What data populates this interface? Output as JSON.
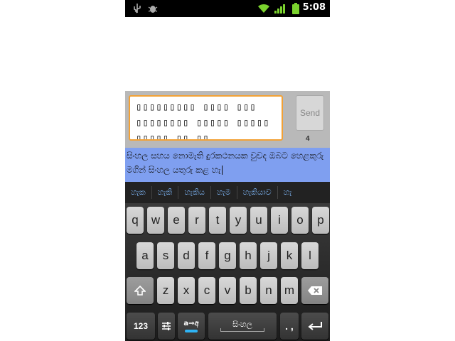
{
  "status_bar": {
    "time": "5:08",
    "icons": [
      "usb-icon",
      "debug-bug-icon",
      "wifi-icon",
      "signal-icon",
      "battery-icon"
    ]
  },
  "compose": {
    "message_text": "▯▯▯▯▯▯▯▯▯ ▯▯▯▯ ▯▯▯ ▯▯▯▯▯▯▯▯ ▯▯▯▯▯ ▯▯▯▯▯ ▯▯▯▯▯ ▯▯ ▯▯",
    "send_label": "Send",
    "char_count": "4"
  },
  "composing_text": "සිංහල සහය නොමැති දුරකථනයක වුවද ඔබට හෙළකුරු මගින් සිංහල යතුරු කළ හැ",
  "suggestions": [
    "හැක",
    "හැකි",
    "හැකිය",
    "හැම",
    "හැකියාව",
    "හැ"
  ],
  "keyboard": {
    "row1": [
      "q",
      "w",
      "e",
      "r",
      "t",
      "y",
      "u",
      "i",
      "o",
      "p"
    ],
    "row2": [
      "a",
      "s",
      "d",
      "f",
      "g",
      "h",
      "j",
      "k",
      "l"
    ],
    "row3": [
      "z",
      "x",
      "c",
      "v",
      "b",
      "n",
      "m"
    ],
    "symbols_label": "123",
    "transliterate_label": "a⇒අ",
    "space_label": "සිංහල",
    "punct_label": ". ,"
  },
  "colors": {
    "input_border": "#f2a136",
    "composing_bg": "#7f9ff0",
    "suggestion_text": "#7ab0ee",
    "status_bar_green": "#7bd32e"
  }
}
